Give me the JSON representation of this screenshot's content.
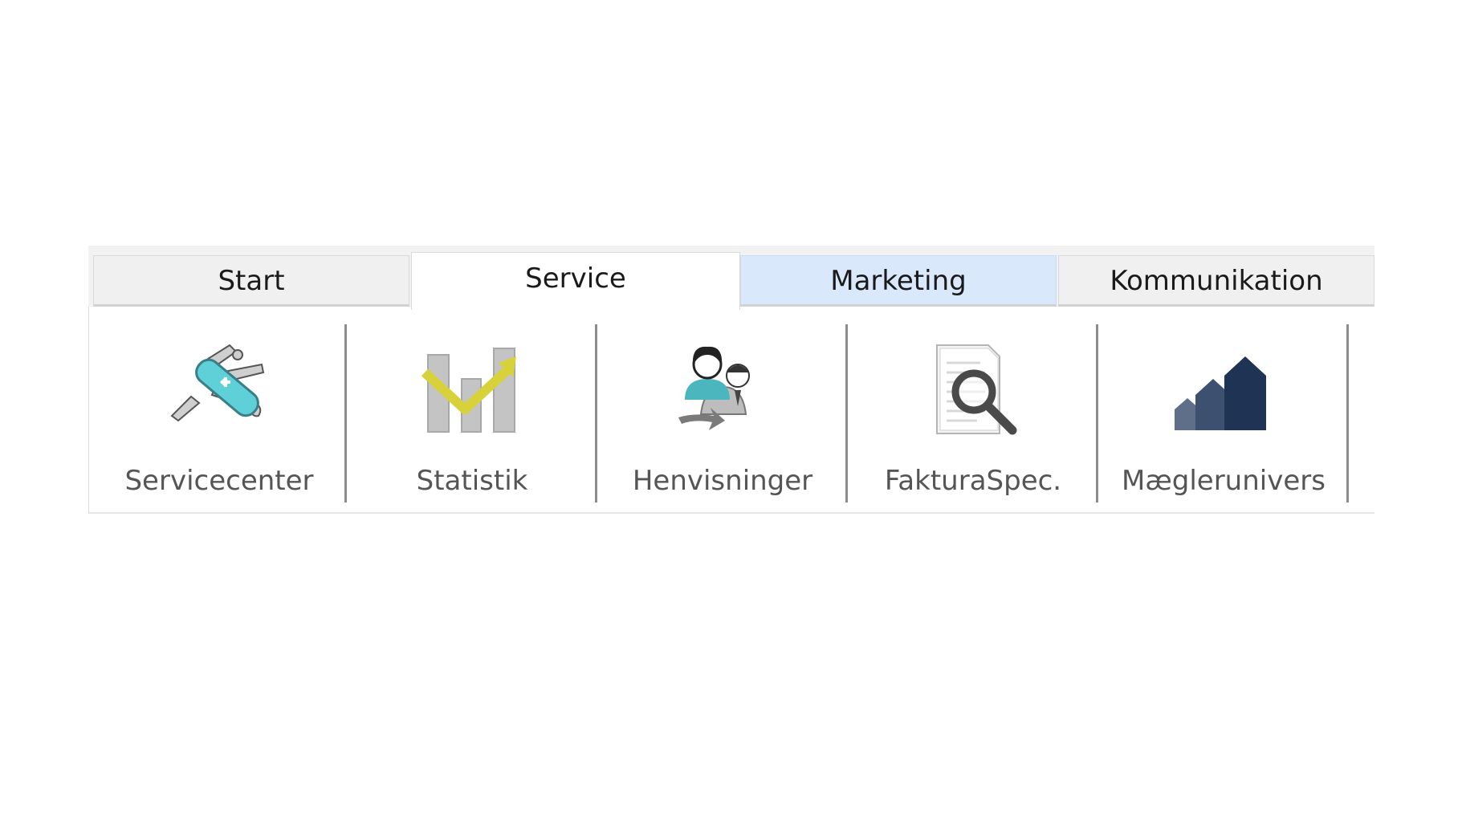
{
  "tabs": [
    {
      "label": "Start",
      "state": "normal"
    },
    {
      "label": "Service",
      "state": "active"
    },
    {
      "label": "Marketing",
      "state": "hover"
    },
    {
      "label": "Kommunikation",
      "state": "normal"
    }
  ],
  "tools": [
    {
      "label": "Servicecenter",
      "icon": "swiss-army-knife-icon"
    },
    {
      "label": "Statistik",
      "icon": "bar-chart-trend-icon"
    },
    {
      "label": "Henvisninger",
      "icon": "people-referral-icon"
    },
    {
      "label": "FakturaSpec.",
      "icon": "document-magnifier-icon"
    },
    {
      "label": "Mæglerunivers",
      "icon": "houses-icon"
    }
  ],
  "colors": {
    "active_tab": "#ffffff",
    "hover_tab": "#d9e8fb",
    "tab_bar": "#f2f2f2",
    "label_text": "#555555",
    "separator": "#8c8c8c"
  }
}
